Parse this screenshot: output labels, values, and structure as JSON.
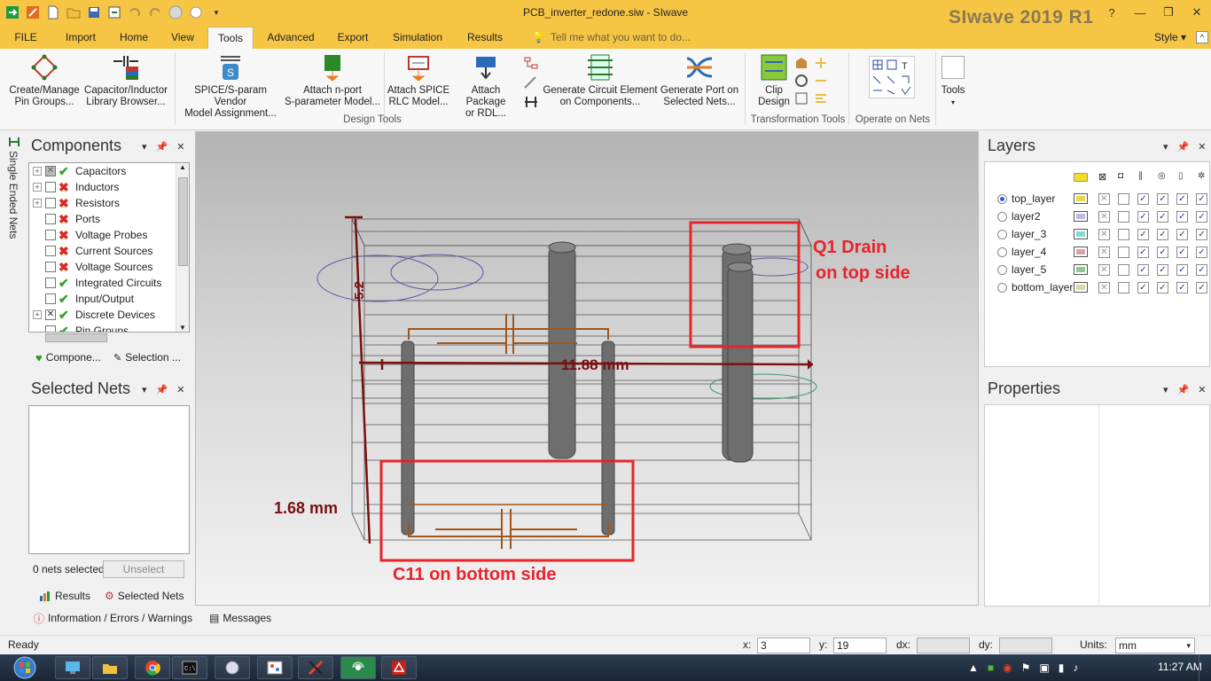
{
  "titlebar": {
    "window_title": "PCB_inverter_redone.siw - SIwave",
    "brand": "SIwave 2019 R1",
    "quick_access_icons": [
      "app-icon",
      "tools-icon",
      "new-file-icon",
      "open-folder-icon",
      "save-icon",
      "export-icon",
      "undo-icon",
      "redo-icon",
      "circle-icon",
      "circle-icon",
      "dropdown-icon"
    ]
  },
  "ribbon_tabs": [
    "FILE",
    "Import",
    "Home",
    "View",
    "Tools",
    "Advanced",
    "Export",
    "Simulation",
    "Results"
  ],
  "active_tab": "Tools",
  "tell_me": "Tell me what you want to do...",
  "style_menu": "Style",
  "ribbon": {
    "design_tools": [
      {
        "label1": "Create/Manage",
        "label2": "Pin Groups...",
        "icon": "pin-groups-icon"
      },
      {
        "label1": "Capacitor/Inductor",
        "label2": "Library Browser...",
        "icon": "capacitor-library-icon"
      },
      {
        "label1": "SPICE/S-param Vendor",
        "label2": "Model Assignment...",
        "icon": "spice-model-icon"
      },
      {
        "label1": "Attach n-port",
        "label2": "S-parameter Model...",
        "icon": "nport-icon"
      },
      {
        "label1": "Attach SPICE",
        "label2": "RLC Model...",
        "icon": "rlc-model-icon"
      },
      {
        "label1": "Attach Package",
        "label2": "or RDL...",
        "icon": "package-icon"
      },
      {
        "label1": "Generate Circuit Element",
        "label2": "on Components...",
        "icon": "circuit-element-icon"
      },
      {
        "label1": "Generate Port on",
        "label2": "Selected Nets...",
        "icon": "port-icon"
      }
    ],
    "clip_design": {
      "label1": "Clip",
      "label2": "Design",
      "icon": "clip-design-icon"
    },
    "tools_button": {
      "label": "Tools",
      "icon": "tools-dropdown-icon"
    },
    "group_labels": {
      "design_tools": "Design Tools",
      "transformation_tools": "Transformation Tools",
      "operate_on_nets": "Operate on Nets"
    }
  },
  "side_tab": "Single Ended Nets",
  "components_pane": {
    "title": "Components",
    "items": [
      {
        "label": "Capacitors",
        "expandable": true,
        "checked": "partial",
        "status": "ok"
      },
      {
        "label": "Inductors",
        "expandable": true,
        "checked": "none",
        "status": "error"
      },
      {
        "label": "Resistors",
        "expandable": true,
        "checked": "none",
        "status": "error"
      },
      {
        "label": "Ports",
        "expandable": false,
        "checked": "none",
        "status": "error"
      },
      {
        "label": "Voltage Probes",
        "expandable": false,
        "checked": "none",
        "status": "error"
      },
      {
        "label": "Current Sources",
        "expandable": false,
        "checked": "none",
        "status": "error"
      },
      {
        "label": "Voltage Sources",
        "expandable": false,
        "checked": "none",
        "status": "error"
      },
      {
        "label": "Integrated Circuits",
        "expandable": false,
        "checked": "none",
        "status": "ok"
      },
      {
        "label": "Input/Output",
        "expandable": false,
        "checked": "none",
        "status": "ok"
      },
      {
        "label": "Discrete Devices",
        "expandable": true,
        "checked": "checked",
        "status": "ok"
      },
      {
        "label": "Pin Groups",
        "expandable": false,
        "checked": "none",
        "status": "ok"
      }
    ],
    "tabs": [
      "Compone...",
      "Selection ..."
    ]
  },
  "selected_nets_pane": {
    "title": "Selected Nets",
    "count_text": "0 nets selected",
    "unselect_label": "Unselect",
    "tabs": [
      "Results",
      "Selected Nets"
    ]
  },
  "canvas": {
    "annotations": {
      "q1_line1": "Q1 Drain",
      "q1_line2": "on top side",
      "c11": "C11 on bottom side",
      "height_dim": "1.68 mm",
      "width_dim": "11.88 mm",
      "small_dim": "5.2"
    },
    "annotation_color": "#e8242b",
    "dimension_color": "#7a1010"
  },
  "layers_pane": {
    "title": "Layers",
    "header_icons": [
      "color-icon",
      "visibility-icon",
      "pads-icon",
      "traces-icon",
      "vias-icon",
      "planes-icon",
      "shapes-icon"
    ],
    "layers": [
      {
        "name": "top_layer",
        "active": true,
        "color": "#e8d848"
      },
      {
        "name": "layer2",
        "active": false,
        "color": "#c0b8e0"
      },
      {
        "name": "layer_3",
        "active": false,
        "color": "#88d8d0"
      },
      {
        "name": "layer_4",
        "active": false,
        "color": "#e0a0a0"
      },
      {
        "name": "layer_5",
        "active": false,
        "color": "#8cc890"
      },
      {
        "name": "bottom_layer",
        "active": false,
        "color": "#d8d8a8"
      }
    ]
  },
  "properties_pane": {
    "title": "Properties"
  },
  "output_tabs": [
    "Information / Errors / Warnings",
    "Messages"
  ],
  "status": {
    "ready": "Ready",
    "x_label": "x:",
    "x_value": "3",
    "y_label": "y:",
    "y_value": "19",
    "dx_label": "dx:",
    "dy_label": "dy:",
    "units_label": "Units:",
    "units_value": "mm"
  },
  "taskbar": {
    "apps": [
      "start-button",
      "remote-icon",
      "explorer-icon",
      "chrome-icon",
      "cmd-icon",
      "app-icon",
      "paint-icon",
      "siwave-icon",
      "radio-icon",
      "acrobat-icon"
    ],
    "time": "11:27 AM"
  }
}
